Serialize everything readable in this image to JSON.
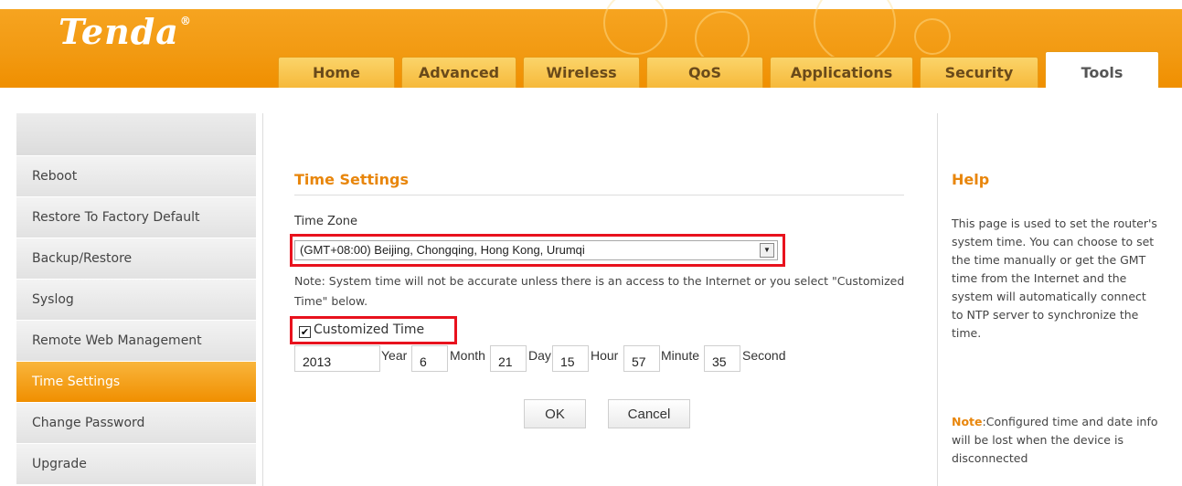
{
  "brand": {
    "logo": "Tenda",
    "trademark": "®"
  },
  "nav": {
    "tabs": [
      {
        "label": "Home"
      },
      {
        "label": "Advanced"
      },
      {
        "label": "Wireless"
      },
      {
        "label": "QoS"
      },
      {
        "label": "Applications"
      },
      {
        "label": "Security"
      },
      {
        "label": "Tools",
        "active": true
      }
    ]
  },
  "sidebar": {
    "items": [
      {
        "label": "Reboot"
      },
      {
        "label": "Restore To Factory Default"
      },
      {
        "label": "Backup/Restore"
      },
      {
        "label": "Syslog"
      },
      {
        "label": "Remote Web Management"
      },
      {
        "label": "Time Settings",
        "active": true
      },
      {
        "label": "Change Password"
      },
      {
        "label": "Upgrade"
      }
    ]
  },
  "main": {
    "title": "Time Settings",
    "time_zone_label": "Time Zone",
    "time_zone_value": "(GMT+08:00) Beijing, Chongqing, Hong Kong, Urumqi",
    "note": "Note: System time will not be accurate unless there is an access to the Internet or you select \"Customized Time\" below.",
    "customized_time_label": "Customized Time",
    "customized_time_checked": true,
    "fields": {
      "year": "2013",
      "year_label": "Year",
      "month": "6",
      "month_label": "Month",
      "day": "21",
      "day_label": "Day",
      "hour": "15",
      "hour_label": "Hour",
      "minute": "57",
      "minute_label": "Minute",
      "second": "35",
      "second_label": "Second"
    },
    "ok_label": "OK",
    "cancel_label": "Cancel"
  },
  "help": {
    "title": "Help",
    "text": "This page is used to set the router's system time. You can choose to set the time manually or get the GMT time from the Internet and the system will automatically connect to NTP server to synchronize the time.",
    "note_label": "Note",
    "note_text": ":Configured time and date info will be lost when the device is disconnected"
  },
  "colors": {
    "accent": "#f29a12",
    "title": "#e8860c",
    "highlight": "#e8121d"
  }
}
